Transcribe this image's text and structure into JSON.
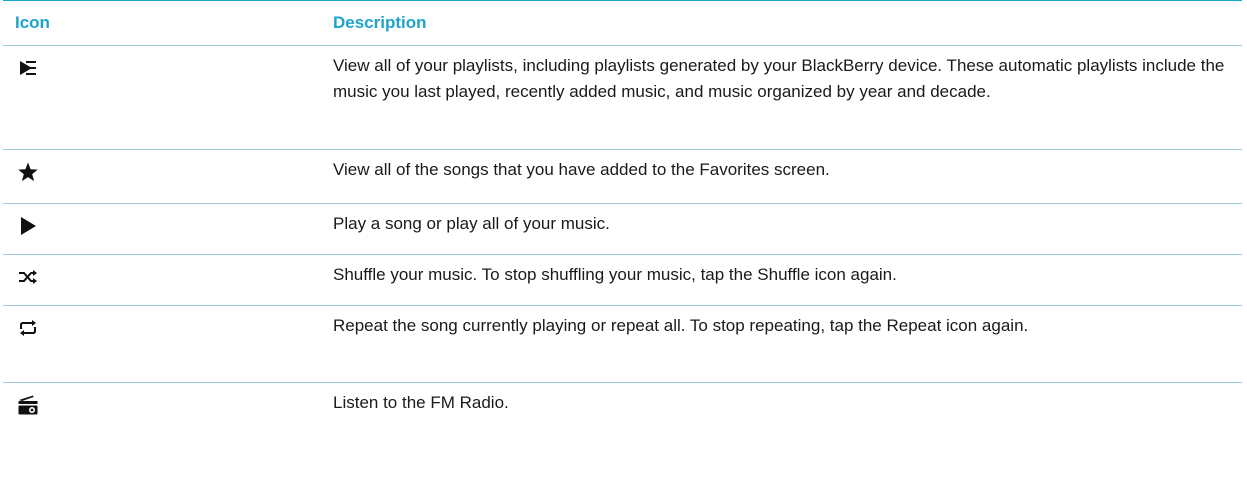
{
  "table": {
    "header": {
      "icon": "Icon",
      "description": "Description"
    },
    "rows": [
      {
        "icon": "playlist-icon",
        "description": "View all of your playlists, including playlists generated by your BlackBerry device. These automatic playlists include the music you last played, recently added music, and music organized by year and decade."
      },
      {
        "icon": "star-icon",
        "description": "View all of the songs that you have added to the Favorites screen."
      },
      {
        "icon": "play-icon",
        "description": "Play a song or play all of your music."
      },
      {
        "icon": "shuffle-icon",
        "description": "Shuffle your music. To stop shuffling your music, tap the Shuffle icon again."
      },
      {
        "icon": "repeat-icon",
        "description": "Repeat the song currently playing or repeat all. To stop repeating, tap the Repeat icon again."
      },
      {
        "icon": "radio-icon",
        "description": "Listen to the FM Radio."
      }
    ]
  },
  "colors": {
    "header_text": "#1ea3cf",
    "rule": "#9ec9d6"
  }
}
